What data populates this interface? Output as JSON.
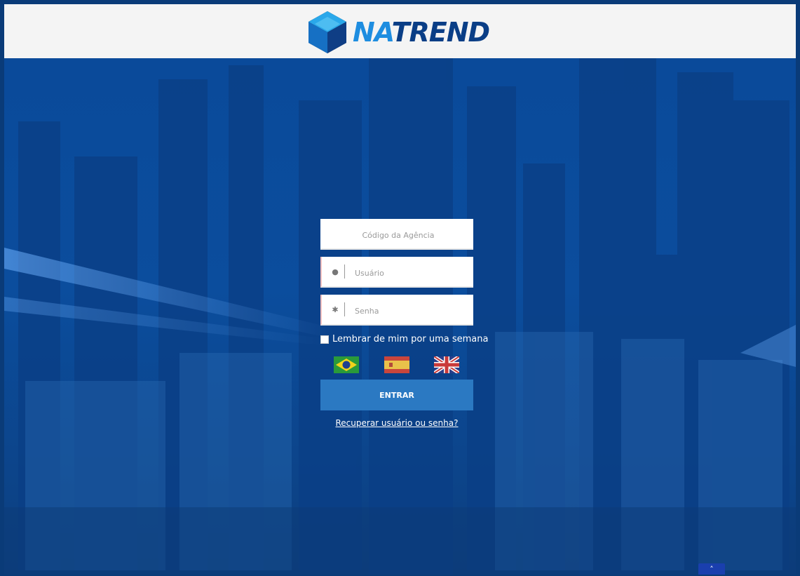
{
  "brand": {
    "logo_part1": "NA",
    "logo_part2": "TREND",
    "logo_icon": "hexagon-cube-icon",
    "colors": {
      "na": "#1e8de0",
      "trend": "#0a3e86",
      "background": "#0a4a9a",
      "button": "#2b79c2"
    }
  },
  "login": {
    "agency_placeholder": "Código da Agência",
    "username_placeholder": "Usuário",
    "username_icon": "user-icon",
    "password_placeholder": "Senha",
    "password_icon": "asterisk-icon",
    "remember_label": "Lembrar de mim por uma semana",
    "remember_checked": false,
    "languages": [
      {
        "name": "brazil-flag-icon"
      },
      {
        "name": "spain-flag-icon"
      },
      {
        "name": "uk-flag-icon"
      }
    ],
    "submit_label": "ENTRAR",
    "recover_label": "Recuperar usuário ou senha?"
  },
  "scroll_top_icon": "chevron-up-icon",
  "scroll_top_glyph": "˄"
}
